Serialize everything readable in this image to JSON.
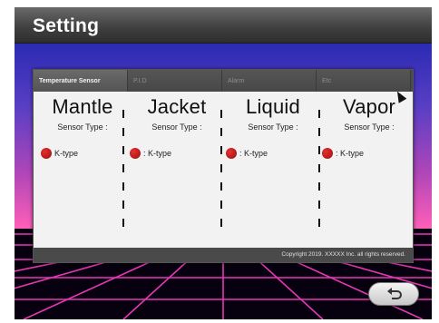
{
  "header": {
    "title": "Setting"
  },
  "tabs": [
    {
      "label": "Temperature Sensor",
      "active": true
    },
    {
      "label": "P.I.D",
      "active": false
    },
    {
      "label": "Alarm",
      "active": false
    },
    {
      "label": "Etc",
      "active": false
    }
  ],
  "sensors": [
    {
      "name": "Mantle",
      "type_label": "Sensor Type :",
      "value": "K-type"
    },
    {
      "name": "Jacket",
      "type_label": "Sensor Type :",
      "value": ": K-type"
    },
    {
      "name": "Liquid",
      "type_label": "Sensor Type :",
      "value": ": K-type"
    },
    {
      "name": "Vapor",
      "type_label": "Sensor Type :",
      "value": ": K-type"
    }
  ],
  "footer": {
    "copyright": "Copyright 2019. XXXXX Inc. all rights reserved."
  },
  "colors": {
    "indicator": "#cc1a1a",
    "titlebar": "#3e3e3e",
    "accent_grid": "#ff3fc8"
  },
  "icons": {
    "back": "return-arrow-icon",
    "cursor": "mouse-pointer-icon"
  }
}
